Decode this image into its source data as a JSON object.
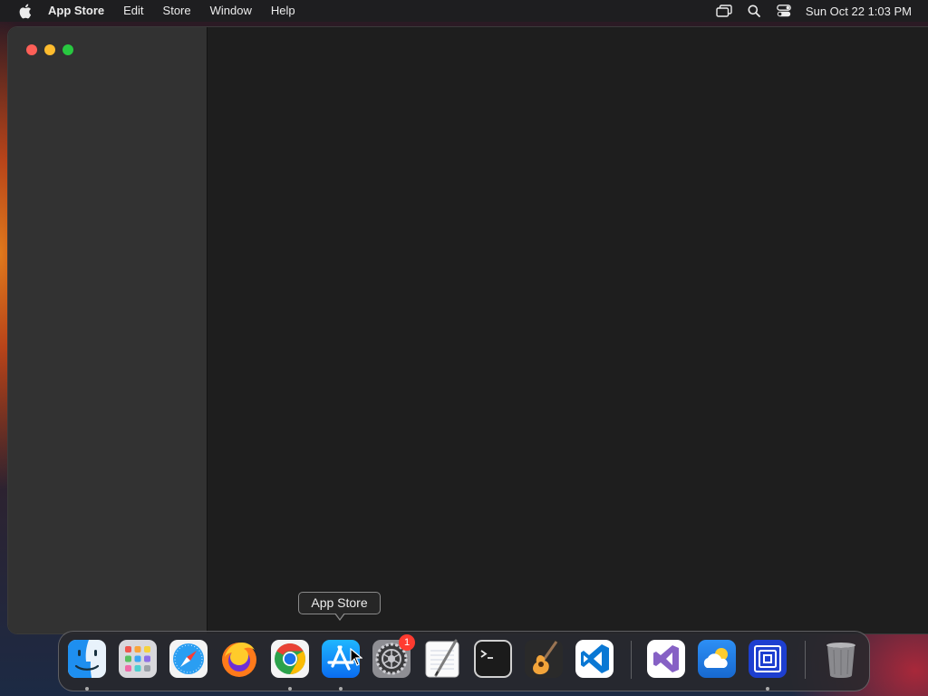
{
  "menubar": {
    "app_name": "App Store",
    "menus": [
      "Edit",
      "Store",
      "Window",
      "Help"
    ],
    "clock": "Sun Oct 22  1:03 PM",
    "status_icons": [
      "screen-mirroring-icon",
      "spotlight-search-icon",
      "control-center-icon"
    ]
  },
  "window": {
    "traffic_lights": [
      "close",
      "minimize",
      "zoom"
    ],
    "colors": {
      "sidebar": "#323232",
      "content": "#1e1e1e"
    }
  },
  "tooltip": {
    "text": "App Store"
  },
  "dock": {
    "apps": [
      {
        "name": "Finder",
        "icon": "finder-icon",
        "running": true
      },
      {
        "name": "Launchpad",
        "icon": "launchpad-icon",
        "running": false
      },
      {
        "name": "Safari",
        "icon": "safari-icon",
        "running": false
      },
      {
        "name": "Firefox",
        "icon": "firefox-icon",
        "running": false
      },
      {
        "name": "Google Chrome",
        "icon": "chrome-icon",
        "running": true
      },
      {
        "name": "App Store",
        "icon": "app-store-icon",
        "running": true
      },
      {
        "name": "System Settings",
        "icon": "system-settings-icon",
        "running": false,
        "badge": "1"
      },
      {
        "name": "TextEdit",
        "icon": "textedit-icon",
        "running": false
      },
      {
        "name": "Terminal",
        "icon": "terminal-icon",
        "running": false
      },
      {
        "name": "GarageBand",
        "icon": "garageband-icon",
        "running": false
      },
      {
        "name": "Visual Studio Code",
        "icon": "vscode-icon",
        "running": false
      },
      {
        "name": "Visual Studio",
        "icon": "visual-studio-icon",
        "running": false
      },
      {
        "name": "Weather",
        "icon": "weather-icon",
        "running": false
      },
      {
        "name": "Simulator",
        "icon": "simulator-icon",
        "running": true
      },
      {
        "name": "Trash",
        "icon": "trash-icon",
        "running": false
      }
    ]
  }
}
